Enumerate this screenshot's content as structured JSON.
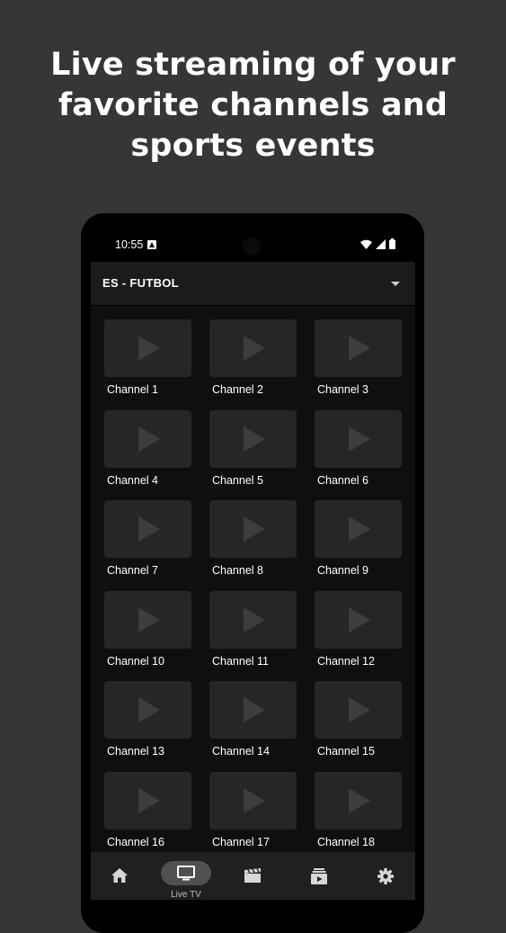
{
  "headline": {
    "line1": "Live streaming of your",
    "line2": "favorite channels and",
    "line3": "sports events"
  },
  "status_bar": {
    "time": "10:55",
    "icons": [
      "notification-a-icon",
      "wifi-icon",
      "signal-icon",
      "battery-icon"
    ]
  },
  "category_select": {
    "selected": "ES - FUTBOL"
  },
  "channels": [
    {
      "label": "Channel 1"
    },
    {
      "label": "Channel 2"
    },
    {
      "label": "Channel 3"
    },
    {
      "label": "Channel 4"
    },
    {
      "label": "Channel 5"
    },
    {
      "label": "Channel 6"
    },
    {
      "label": "Channel 7"
    },
    {
      "label": "Channel 8"
    },
    {
      "label": "Channel 9"
    },
    {
      "label": "Channel 10"
    },
    {
      "label": "Channel 11"
    },
    {
      "label": "Channel 12"
    },
    {
      "label": "Channel 13"
    },
    {
      "label": "Channel 14"
    },
    {
      "label": "Channel 15"
    },
    {
      "label": "Channel 16"
    },
    {
      "label": "Channel 17"
    },
    {
      "label": "Channel 18"
    }
  ],
  "bottom_nav": {
    "items": [
      {
        "icon": "home-icon",
        "label": ""
      },
      {
        "icon": "tv-icon",
        "label": "Live TV",
        "active": true
      },
      {
        "icon": "movie-clapper-icon",
        "label": ""
      },
      {
        "icon": "series-stack-icon",
        "label": ""
      },
      {
        "icon": "settings-gear-icon",
        "label": ""
      }
    ]
  },
  "colors": {
    "page_background": "#363538",
    "phone_background": "#000000",
    "grid_background": "#0f0f10",
    "tile_background": "#262628",
    "active_pill": "#505052"
  }
}
